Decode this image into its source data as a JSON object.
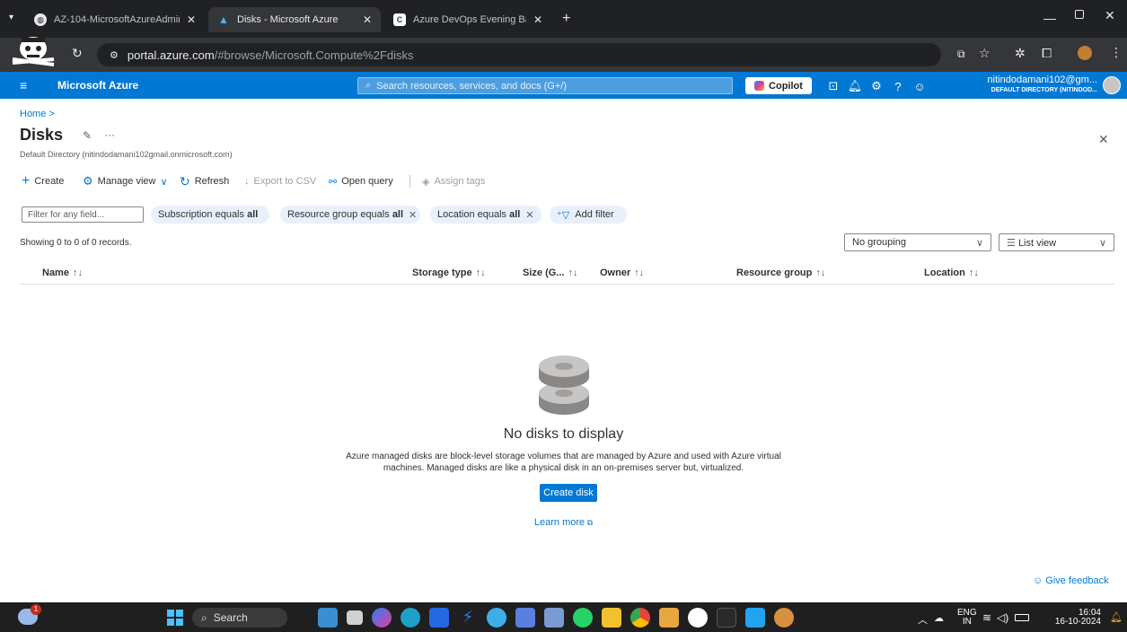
{
  "browser": {
    "tabs": [
      {
        "title": "AZ-104-MicrosoftAzureAdmini",
        "icon": "globe-icon",
        "active": false
      },
      {
        "title": "Disks - Microsoft Azure",
        "icon": "azure-logo-icon",
        "active": true
      },
      {
        "title": "Azure DevOps Evening Batch-",
        "icon": "c-logo-icon",
        "active": false
      }
    ],
    "new_tab": "+",
    "url_host": "portal.azure.com",
    "url_path": "/#browse/Microsoft.Compute%2Fdisks"
  },
  "azure": {
    "brand": "Microsoft Azure",
    "search_placeholder": "Search resources, services, and docs (G+/)",
    "copilot_label": "Copilot",
    "account_name": "nitindodamani102@gm...",
    "account_directory": "DEFAULT DIRECTORY (NITINDOD..."
  },
  "page": {
    "breadcrumb": "Home",
    "breadcrumb_sep": ">",
    "title": "Disks",
    "more": "···",
    "subtitle": "Default Directory (nitindodamani102gmail.onmicrosoft.com)",
    "close": "✕"
  },
  "toolbar": {
    "create": "Create",
    "manage_view": "Manage view",
    "refresh": "Refresh",
    "export": "Export to CSV",
    "open_query": "Open query",
    "assign_tags": "Assign tags"
  },
  "filters": {
    "placeholder": "Filter for any field...",
    "subscription_label": "Subscription equals",
    "subscription_value": "all",
    "rg_label": "Resource group equals",
    "rg_value": "all",
    "location_label": "Location equals",
    "location_value": "all",
    "add_filter": "Add filter"
  },
  "list": {
    "showing": "Showing 0 to 0 of 0 records.",
    "grouping": "No grouping",
    "view": "List view",
    "sort_glyph": "↑↓",
    "columns": [
      "Name",
      "Storage type",
      "Size (G...",
      "Owner",
      "Resource group",
      "Location"
    ]
  },
  "empty": {
    "title": "No disks to display",
    "desc_line1": "Azure managed disks are block-level storage volumes that are managed by Azure and used with Azure virtual",
    "desc_line2": "machines. Managed disks are like a physical disk in an on-premises server but, virtualized.",
    "create_button": "Create disk",
    "learn_more": "Learn more"
  },
  "feedback": "Give feedback",
  "taskbar": {
    "search": "Search",
    "lang_top": "ENG",
    "lang_bottom": "IN",
    "time": "16:04",
    "date": "16-10-2024",
    "weather_badge": "1"
  },
  "colors": {
    "azure_blue": "#0078d4",
    "chrome_dark": "#202124",
    "pill_bg": "#e8f0fb"
  }
}
